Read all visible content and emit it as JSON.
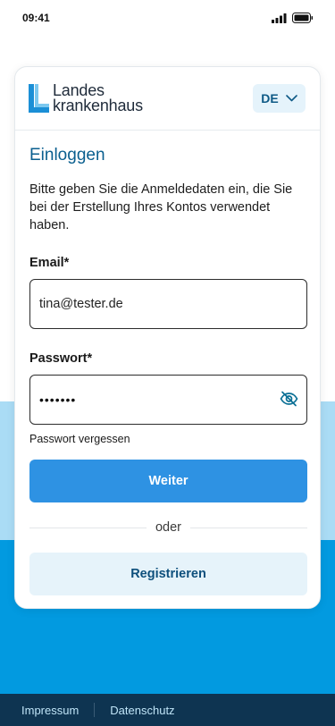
{
  "status_bar": {
    "time": "09:41"
  },
  "header": {
    "logo_line1": "Landes",
    "logo_line2": "krankenhaus",
    "language": "DE"
  },
  "login": {
    "title": "Einloggen",
    "intro": "Bitte geben Sie die Anmeldedaten ein, die Sie bei der Erstellung Ihres Kontos verwendet haben.",
    "email_label": "Email*",
    "email_value": "tina@tester.de",
    "password_label": "Passwort*",
    "password_masked": "•••••••",
    "forgot_link": "Passwort vergessen",
    "submit_label": "Weiter",
    "divider_text": "oder",
    "register_label": "Registrieren"
  },
  "footer": {
    "impressum": "Impressum",
    "datenschutz": "Datenschutz"
  },
  "colors": {
    "primary": "#2e92e3",
    "title": "#0a5f8f",
    "bg_light": "#aadcf5",
    "bg_blue": "#029ae0",
    "footer": "#0e3451"
  }
}
